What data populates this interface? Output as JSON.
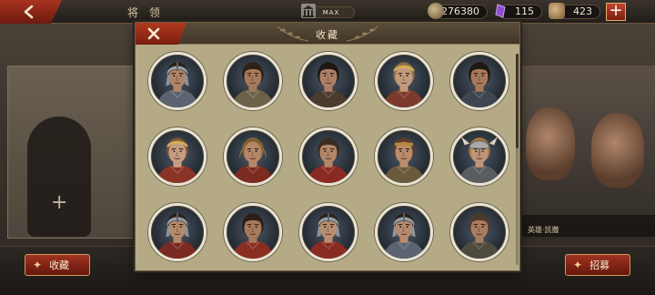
{
  "topbar": {
    "title": "将 领",
    "museum_label": "MAX",
    "coins": "276380",
    "gems": "115",
    "horns": "423",
    "add_label": "+"
  },
  "modal": {
    "title": "收藏",
    "portraits": [
      {
        "helmet": "steel",
        "skin": "#b08468",
        "hair": "#2a211a",
        "armor": "#5b6470"
      },
      {
        "helmet": "none",
        "skin": "#a57a5c",
        "hair": "#2d2118",
        "armor": "#6b6249"
      },
      {
        "helmet": "none",
        "skin": "#ad8066",
        "hair": "#1f1813",
        "armor": "#4a3b2f"
      },
      {
        "helmet": "laurel",
        "skin": "#c39a7c",
        "hair": "#8a6a4c",
        "armor": "#7a3b2c"
      },
      {
        "helmet": "none",
        "skin": "#a9785b",
        "hair": "#1e1813",
        "armor": "#3e4650"
      },
      {
        "helmet": "laurel",
        "skin": "#c59d80",
        "hair": "#7a5535",
        "armor": "#8a3426"
      },
      {
        "helmet": "lion",
        "skin": "#b5876a",
        "hair": "#8a6436",
        "armor": "#7b2b20"
      },
      {
        "helmet": "none",
        "skin": "#b28668",
        "hair": "#3a2c22",
        "armor": "#8b2a22"
      },
      {
        "helmet": "band",
        "skin": "#b98d6e",
        "hair": "#5a3d28",
        "armor": "#6c5a3c"
      },
      {
        "helmet": "winged",
        "skin": "#c09577",
        "hair": "#a8783c",
        "armor": "#5a5c60"
      },
      {
        "helmet": "steel",
        "skin": "#b38a6c",
        "hair": "#2a211a",
        "armor": "#7a2a22"
      },
      {
        "helmet": "none",
        "skin": "#a87a5c",
        "hair": "#2b2018",
        "armor": "#8a2e22"
      },
      {
        "helmet": "steel",
        "skin": "#b88d70",
        "hair": "#2a211a",
        "armor": "#8a2b22"
      },
      {
        "helmet": "steel",
        "skin": "#b58a6d",
        "hair": "#2a211a",
        "armor": "#5b6470"
      },
      {
        "helmet": "none",
        "skin": "#a77c60",
        "hair": "#4a3a2e",
        "armor": "#4e4a3e"
      }
    ]
  },
  "background": {
    "right_card_label": "英雄·凯撒",
    "collect_label": "收藏",
    "recruit_label": "招募"
  },
  "colors": {
    "accent_red": "#9f3320",
    "panel": "#b5aa86"
  },
  "icons": [
    "back-arrow-icon",
    "museum-icon",
    "coin-icon",
    "gem-icon",
    "horn-icon",
    "close-icon"
  ]
}
